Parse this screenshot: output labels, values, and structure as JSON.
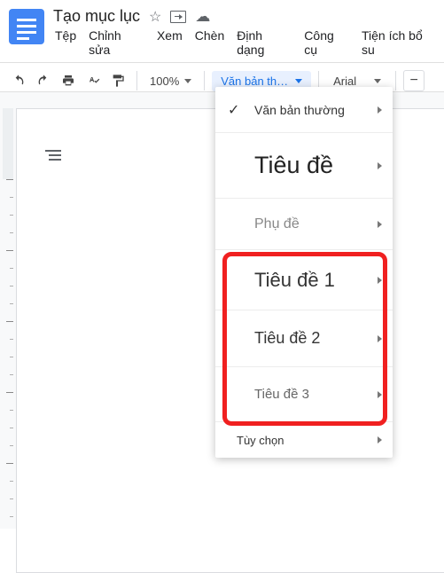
{
  "header": {
    "doc_title": "Tạo mục lục"
  },
  "menu": {
    "file": "Tệp",
    "edit": "Chỉnh sửa",
    "view": "Xem",
    "insert": "Chèn",
    "format": "Định dạng",
    "tools": "Công cụ",
    "extensions": "Tiện ích bổ su"
  },
  "toolbar": {
    "zoom": "100%",
    "style_label": "Văn bản th…",
    "font": "Arial",
    "minus": "−"
  },
  "dropdown": {
    "normal": "Văn bản thường",
    "title": "Tiêu đề",
    "subtitle": "Phụ đề",
    "h1": "Tiêu đề 1",
    "h2": "Tiêu đề 2",
    "h3": "Tiêu đề 3",
    "options": "Tùy chọn"
  }
}
